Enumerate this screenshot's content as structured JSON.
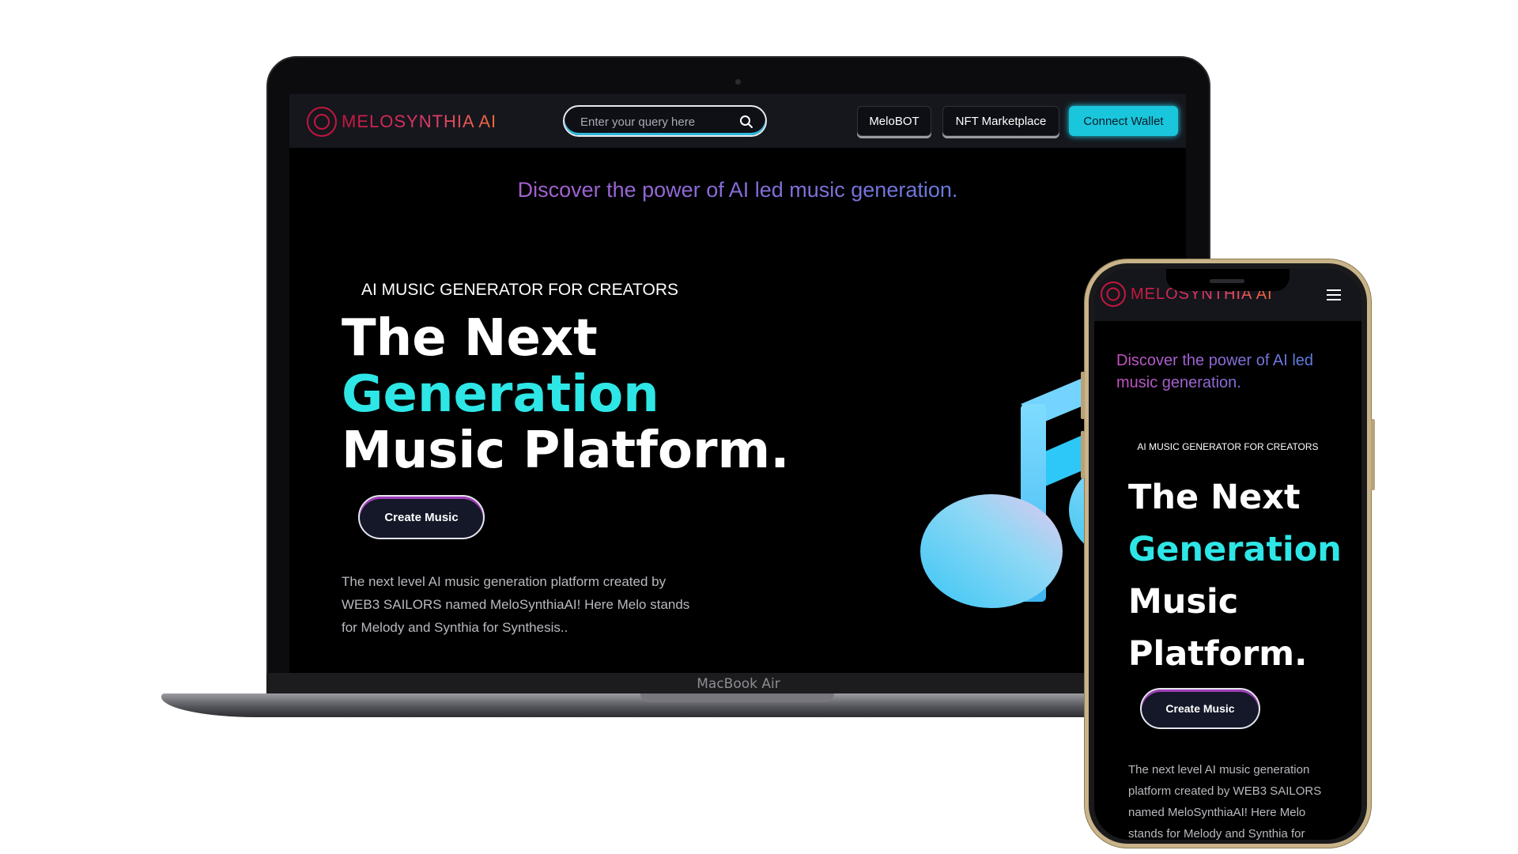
{
  "brand": {
    "logo_text": "MELOSYNTHIA AI",
    "logo_icon": "circle-logo-icon",
    "accent_red": "#c4163f",
    "accent_cyan": "#2ee6e6"
  },
  "laptop": {
    "brand_label": "MacBook Air",
    "nav": {
      "search_placeholder": "Enter your query here",
      "search_icon": "search-icon",
      "melobot_label": "MeloBOT",
      "nft_label": "NFT Marketplace",
      "connect_label": "Connect Wallet"
    },
    "hero": {
      "tagline": "Discover the power of AI led music generation.",
      "eyebrow": "AI MUSIC GENERATOR FOR CREATORS",
      "title_line1": "The Next",
      "title_line2": "Generation",
      "title_line3": "Music Platform.",
      "cta_label": "Create Music",
      "description": "The next level AI music generation platform created by WEB3 SAILORS named MeloSynthiaAI! Here Melo stands for Melody and Synthia for Synthesis.."
    }
  },
  "phone": {
    "nav": {
      "menu_icon": "hamburger-menu-icon"
    },
    "hero": {
      "tagline": "Discover the power of AI led music generation.",
      "eyebrow": "AI MUSIC GENERATOR FOR CREATORS",
      "title_line1": "The Next",
      "title_line2": "Generation",
      "title_line3": "Music",
      "title_line4": "Platform.",
      "cta_label": "Create Music",
      "description": "The next level AI music generation platform created by WEB3 SAILORS named MeloSynthiaAI! Here Melo stands for Melody and Synthia for"
    }
  }
}
